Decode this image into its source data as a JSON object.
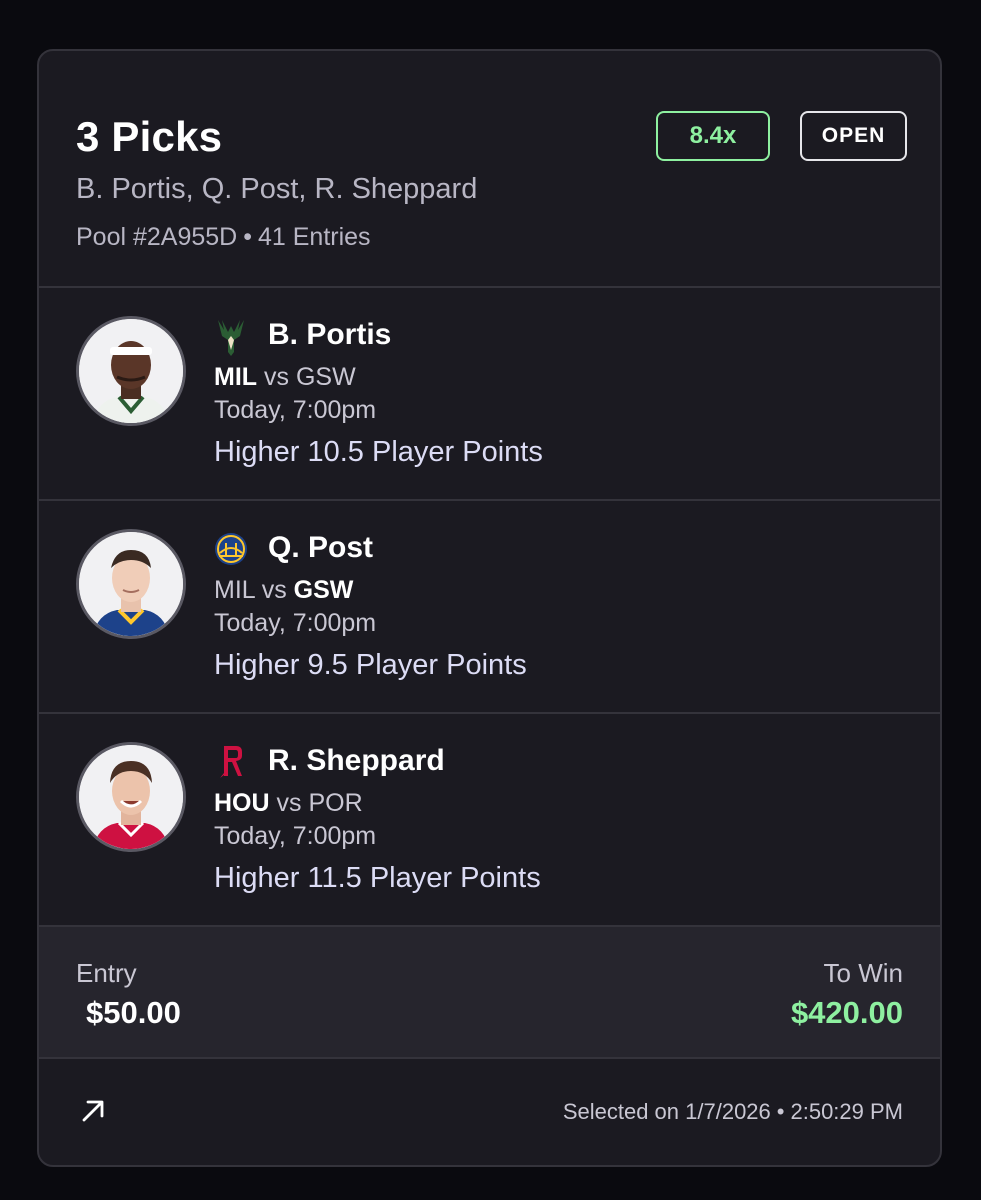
{
  "slip": {
    "title": "3 Picks",
    "players_summary": "B. Portis, Q. Post, R. Sheppard",
    "pool_label": "Pool #2A955D",
    "entries_label": "41 Entries",
    "separator": "•",
    "multiplier": "8.4x",
    "status": "OPEN"
  },
  "picks": [
    {
      "player": "B. Portis",
      "team_logo": "bucks-logo",
      "home": "MIL",
      "vs": "vs",
      "away": "GSW",
      "bold_team": "home",
      "time": "Today, 7:00pm",
      "projection": "Higher 10.5 Player Points",
      "jersey_color": "#eef2ee"
    },
    {
      "player": "Q. Post",
      "team_logo": "warriors-logo",
      "home": "MIL",
      "vs": "vs",
      "away": "GSW",
      "bold_team": "away",
      "time": "Today, 7:00pm",
      "projection": "Higher 9.5 Player Points",
      "jersey_color": "#1d428a"
    },
    {
      "player": "R. Sheppard",
      "team_logo": "rockets-logo",
      "home": "HOU",
      "vs": "vs",
      "away": "POR",
      "bold_team": "home",
      "time": "Today, 7:00pm",
      "projection": "Higher 11.5 Player Points",
      "jersey_color": "#ce1141"
    }
  ],
  "summary": {
    "entry_label": "Entry",
    "entry_value": "$50.00",
    "win_label": "To Win",
    "win_value": "$420.00"
  },
  "footer": {
    "share_icon": "arrow-up-right-icon",
    "selected_prefix": "Selected on 1/7/2026",
    "separator": "•",
    "selected_time": "2:50:29 PM"
  },
  "colors": {
    "background": "#0a0a0f",
    "card": "#1b1a21",
    "accent_green": "#8ef0a0",
    "divider": "#34333b"
  }
}
